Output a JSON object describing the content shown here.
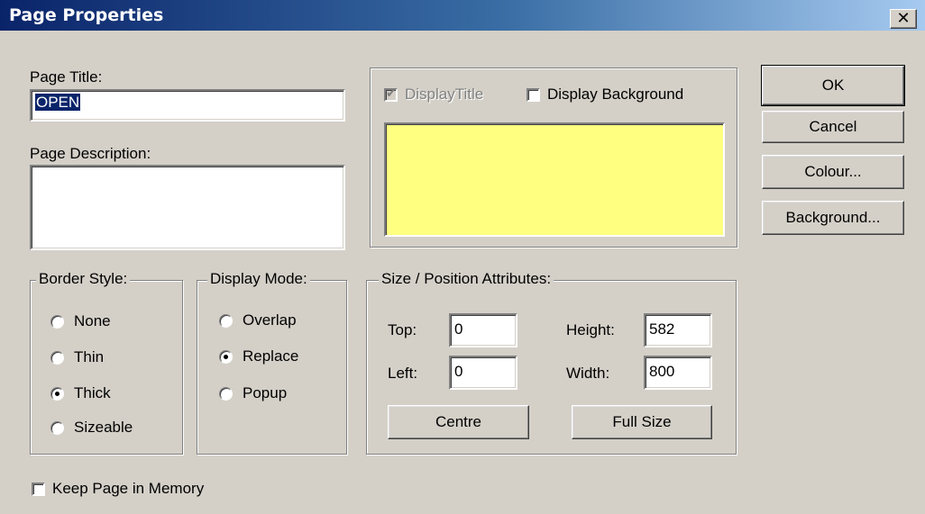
{
  "window": {
    "title": "Page Properties",
    "close_symbol": "✕"
  },
  "page_title": {
    "label": "Page Title:",
    "value": "OPEN"
  },
  "page_description": {
    "label": "Page Description:",
    "value": ""
  },
  "display": {
    "display_title_label": "DisplayTitle",
    "display_title_checked": true,
    "display_title_enabled": false,
    "display_background_label": "Display Background",
    "display_background_checked": false,
    "preview_color": "#ffff80"
  },
  "buttons": {
    "ok": "OK",
    "cancel": "Cancel",
    "colour": "Colour...",
    "background": "Background..."
  },
  "border_style": {
    "label": "Border Style:",
    "options": [
      "None",
      "Thin",
      "Thick",
      "Sizeable"
    ],
    "selected": "Thick"
  },
  "display_mode": {
    "label": "Display Mode:",
    "options": [
      "Overlap",
      "Replace",
      "Popup"
    ],
    "selected": "Replace"
  },
  "size_position": {
    "label": "Size / Position Attributes:",
    "top_label": "Top:",
    "top_value": "0",
    "left_label": "Left:",
    "left_value": "0",
    "height_label": "Height:",
    "height_value": "582",
    "width_label": "Width:",
    "width_value": "800",
    "centre_button": "Centre",
    "fullsize_button": "Full Size"
  },
  "keep_in_memory": {
    "label": "Keep Page in Memory",
    "checked": false
  }
}
